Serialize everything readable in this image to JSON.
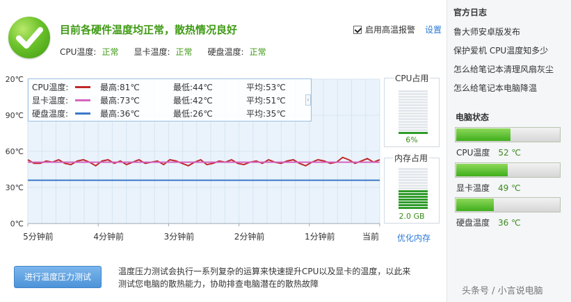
{
  "header": {
    "headline": "目前各硬件温度均正常，散热情况良好",
    "cpu_label": "CPU温度:",
    "cpu_status": "正常",
    "gpu_label": "显卡温度:",
    "gpu_status": "正常",
    "disk_label": "硬盘温度:",
    "disk_status": "正常",
    "alarm_label": "启用高温报警",
    "alarm_checked": true,
    "settings_label": "设置"
  },
  "legend": [
    {
      "name": "CPU温度:",
      "color": "#c0282a",
      "max": "最高:81℃",
      "min": "最低:44℃",
      "avg": "平均:53℃"
    },
    {
      "name": "显卡温度:",
      "color": "#d464c0",
      "max": "最高:73℃",
      "min": "最低:42℃",
      "avg": "平均:51℃"
    },
    {
      "name": "硬盘温度:",
      "color": "#3a78c8",
      "max": "最高:36℃",
      "min": "最低:26℃",
      "avg": "平均:35℃"
    }
  ],
  "chart_data": {
    "type": "line",
    "y_tick_labels": [
      "20℃",
      "90℃",
      "60℃",
      "30℃",
      "0℃"
    ],
    "y_tick_values": [
      120,
      90,
      60,
      30,
      0
    ],
    "ylim": [
      0,
      120
    ],
    "x_tick_labels": [
      "5分钟前",
      "4分钟前",
      "3分钟前",
      "2分钟前",
      "1分钟前",
      "当前"
    ],
    "grid": true,
    "series": [
      {
        "name": "CPU温度",
        "color": "#c0282a",
        "values": [
          53,
          50,
          50,
          52,
          51,
          53,
          50,
          49,
          52,
          53,
          51,
          48,
          52,
          53,
          50,
          52,
          49,
          51,
          53,
          50,
          51,
          52,
          49,
          53,
          52,
          50,
          48,
          51,
          53,
          49,
          50,
          52,
          51,
          53,
          50,
          49,
          51,
          52,
          50,
          53,
          51,
          50,
          52,
          53,
          50,
          48,
          51,
          53,
          52,
          50,
          51,
          55,
          53,
          50,
          52,
          54,
          51,
          53
        ]
      },
      {
        "name": "显卡温度",
        "color": "#d464c0",
        "values": [
          51,
          51,
          51,
          51,
          51,
          51,
          51,
          51,
          51,
          51,
          51,
          51,
          51,
          51,
          51,
          51,
          51,
          51,
          51,
          51,
          51,
          51,
          51,
          51,
          51,
          51,
          51,
          51,
          51,
          51,
          51,
          51,
          51,
          51,
          51,
          51,
          51,
          51,
          51,
          51,
          51,
          51,
          51,
          51,
          51,
          51,
          51,
          51,
          51,
          51,
          51,
          51,
          51,
          51,
          51,
          51,
          51,
          51
        ]
      },
      {
        "name": "硬盘温度",
        "color": "#3a78c8",
        "values": [
          36,
          36,
          36,
          36,
          36,
          36,
          36,
          36,
          36,
          36,
          36,
          36,
          36,
          36,
          36,
          36,
          36,
          36,
          36,
          36,
          36,
          36,
          36,
          36,
          36,
          36,
          36,
          36,
          36,
          36,
          36,
          36,
          36,
          36,
          36,
          36,
          36,
          36,
          36,
          36,
          36,
          36,
          36,
          36,
          36,
          36,
          36,
          36,
          36,
          36,
          36,
          36,
          36,
          36,
          36,
          36,
          36,
          36
        ]
      }
    ]
  },
  "gauges": {
    "cpu": {
      "title": "CPU占用",
      "value_text": "6%",
      "fraction": 0.06
    },
    "mem": {
      "title": "内存占用",
      "value_text": "2.0 GB",
      "fraction": 0.45
    },
    "optimize_label": "优化内存"
  },
  "bottom": {
    "stress_button": "进行温度压力测试",
    "desc_line1": "温度压力测试会执行一系列复杂的运算来快速提升CPU以及显卡的温度，以此来",
    "desc_line2": "测试您电脑的散热能力，协助排查电脑潜在的散热故障"
  },
  "sidebar": {
    "news_title": "官方日志",
    "news": [
      "鲁大师安卓版发布",
      "保护爱机 CPU温度知多少",
      "怎么给笔记本清理风扇灰尘",
      "怎么给笔记本电脑降温"
    ],
    "status_title": "电脑状态",
    "status": [
      {
        "label": "CPU温度",
        "value": "52 ℃",
        "fraction": 0.52
      },
      {
        "label": "显卡温度",
        "value": "49 ℃",
        "fraction": 0.49
      },
      {
        "label": "硬盘温度",
        "value": "36 ℃",
        "fraction": 0.36
      }
    ]
  },
  "watermark": "头条号 / 小言说电脑"
}
